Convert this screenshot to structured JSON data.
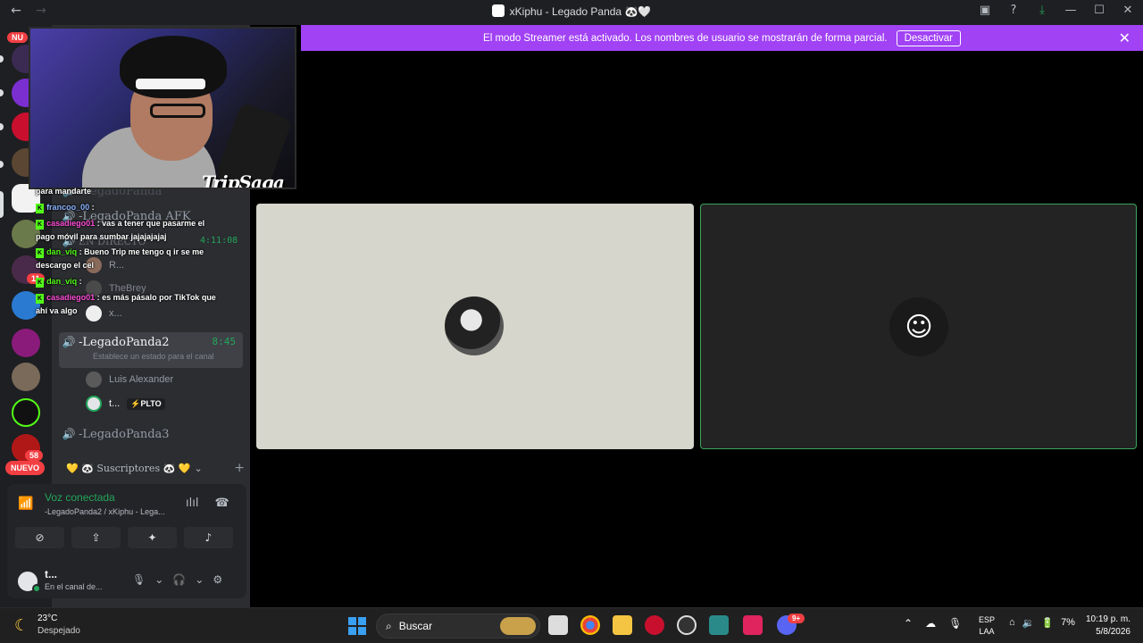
{
  "titlebar": {
    "title": "xKiphu - Legado Panda",
    "title_suffix": "🐼🤍",
    "back_label": "←",
    "forward_label": "→"
  },
  "banner": {
    "message": "El modo Streamer está activado. Los nombres de usuario se mostrarán de forma parcial.",
    "button_label": "Desactivar",
    "close_label": "✕"
  },
  "rail": {
    "top_badge": "NU",
    "badge_11": "11",
    "badge_58": "58",
    "nuevo_label": "NUEVO"
  },
  "channels": {
    "ghost_1": "-LegadoPanda",
    "ghost_2": "-LegadoPanda AFK",
    "ghost_3": "EN DIRECTO",
    "ghost_user_r": "R...",
    "ghost_user_thebrey": "TheBrey",
    "ghost_user_x": "x...",
    "active": {
      "name": "-LegadoPanda2",
      "time": "8:45",
      "status": "Establece un estado para el canal"
    },
    "users": [
      {
        "name": "Luis Alexander"
      },
      {
        "name": "t...",
        "badge": "⚡PLTO"
      }
    ],
    "channel_3": "-LegadoPanda3",
    "category": "💛 🐼 Suscriptores 🐼 💛"
  },
  "chat": {
    "time": "4:11:08",
    "lines": [
      {
        "text": "para mandarte"
      },
      {
        "user": "francoo_00",
        "text": ":"
      },
      {
        "user": "casadiego01",
        "text": ": vas a tener que pasarme el"
      },
      {
        "text": "pago móvil para sumbar jajajajajaj"
      },
      {
        "user": "dan_viq",
        "text": ": Bueno Trip me tengo q ir se me"
      },
      {
        "text": "descargo el cel"
      },
      {
        "user": "dan_viq",
        "text": ":"
      },
      {
        "user": "casadiego01",
        "text": ": es más pásalo por TikTok que"
      },
      {
        "text": "ahí va algo"
      }
    ]
  },
  "webcam": {
    "logo_text": "TripSaga"
  },
  "voice": {
    "title": "Voz conectada",
    "subtitle": "-LegadoPanda2 / xKiphu - Lega..."
  },
  "user_panel": {
    "name": "t...",
    "status": "En el canal de..."
  },
  "taskbar": {
    "temp": "23°C",
    "weather": "Despejado",
    "search_label": "Buscar",
    "lang_1": "ESP",
    "lang_2": "LAA",
    "battery": "7%",
    "time": "10:19 p. m.",
    "date": "5/8/2026",
    "discord_badge": "9+"
  }
}
